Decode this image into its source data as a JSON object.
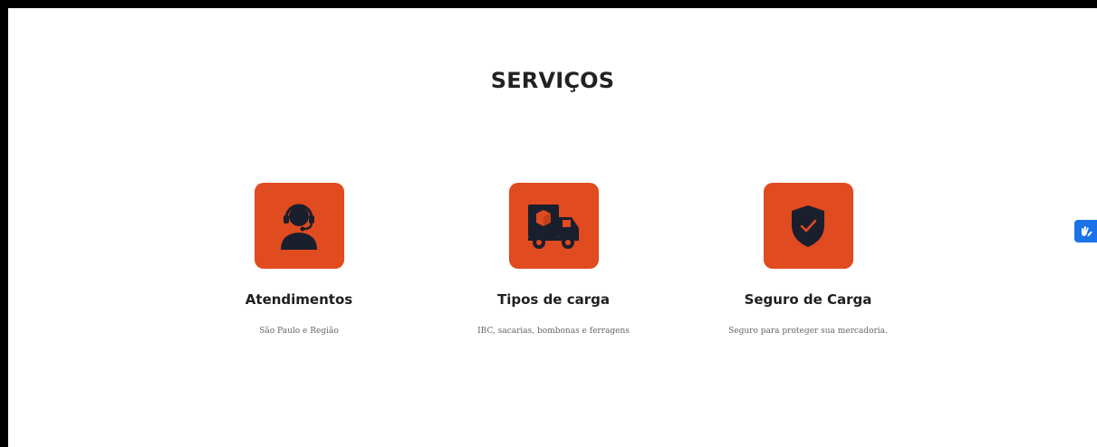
{
  "section": {
    "title": "SERVIÇOS"
  },
  "services": [
    {
      "title": "Atendimentos",
      "description": "São Paulo e Região",
      "icon": "headset-agent-icon"
    },
    {
      "title": "Tipos de carga",
      "description": "IBC, sacarias, bombonas e ferragens",
      "icon": "delivery-truck-icon"
    },
    {
      "title": "Seguro de Carga",
      "description": "Seguro para proteger sua mercadoria.",
      "icon": "shield-check-icon"
    }
  ],
  "accessibility_widget": {
    "icon": "sign-language-hands-icon"
  },
  "colors": {
    "accent": "#e04b1f",
    "icon_dark": "#1a1f2e",
    "widget_blue": "#1a73e8"
  }
}
